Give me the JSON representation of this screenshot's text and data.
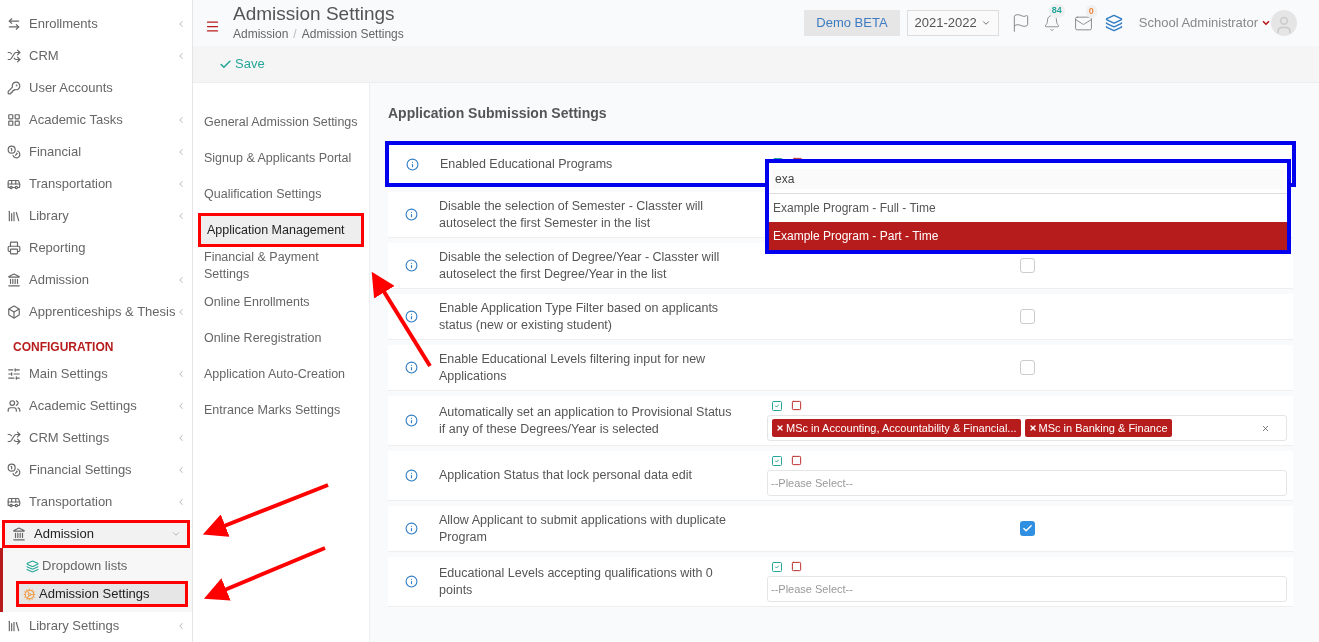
{
  "sidebar": {
    "items": [
      {
        "label": "Enrollments",
        "expandable": true,
        "expanded": false,
        "annotated": false
      },
      {
        "label": "CRM",
        "expandable": true,
        "expanded": false,
        "annotated": false
      },
      {
        "label": "User Accounts",
        "expandable": false,
        "annotated": false
      },
      {
        "label": "Academic Tasks",
        "expandable": true,
        "expanded": false,
        "annotated": false
      },
      {
        "label": "Financial",
        "expandable": true,
        "expanded": false,
        "annotated": false
      },
      {
        "label": "Transportation",
        "expandable": true,
        "expanded": false,
        "annotated": false
      },
      {
        "label": "Library",
        "expandable": true,
        "expanded": false,
        "annotated": false
      },
      {
        "label": "Reporting",
        "expandable": false,
        "annotated": false
      },
      {
        "label": "Admission",
        "expandable": true,
        "expanded": false,
        "annotated": false
      },
      {
        "label": "Apprenticeships & Thesis",
        "expandable": true,
        "expanded": false,
        "annotated": false
      }
    ],
    "section_header": "CONFIGURATION",
    "config_items": [
      {
        "label": "Main Settings",
        "expandable": true,
        "expanded": false,
        "annotated": false
      },
      {
        "label": "Academic Settings",
        "expandable": true,
        "expanded": false,
        "annotated": false
      },
      {
        "label": "CRM Settings",
        "expandable": true,
        "expanded": false,
        "annotated": false
      },
      {
        "label": "Financial Settings",
        "expandable": true,
        "expanded": false,
        "annotated": false
      },
      {
        "label": "Transportation",
        "expandable": true,
        "expanded": false,
        "annotated": false
      },
      {
        "label": "Admission",
        "expandable": true,
        "expanded": true,
        "annotated": true,
        "children": [
          {
            "label": "Dropdown lists",
            "selected": false,
            "annotated": false
          },
          {
            "label": "Admission Settings",
            "selected": true,
            "annotated": true
          }
        ]
      },
      {
        "label": "Library Settings",
        "expandable": true,
        "expanded": false,
        "annotated": false
      }
    ]
  },
  "header": {
    "title": "Admission Settings",
    "breadcrumb": [
      "Admission",
      "Admission Settings"
    ],
    "breadcrumb_separator": "/",
    "demo_button": "Demo BETA",
    "year_select": "2021-2022",
    "notifications_badge": "84",
    "messages_badge": "0",
    "user": "School Administrator"
  },
  "toolbar": {
    "save": "Save"
  },
  "settings_nav": [
    {
      "label": "General Admission Settings",
      "selected": false,
      "annotated": false
    },
    {
      "label": "Signup & Applicants Portal",
      "selected": false,
      "annotated": false
    },
    {
      "label": "Qualification Settings",
      "selected": false,
      "annotated": false
    },
    {
      "label": "Application Management",
      "selected": true,
      "annotated": true
    },
    {
      "label": "Financial & Payment Settings",
      "selected": false,
      "annotated": false
    },
    {
      "label": "Online Enrollments",
      "selected": false,
      "annotated": false
    },
    {
      "label": "Online Reregistration",
      "selected": false,
      "annotated": false
    },
    {
      "label": "Application Auto-Creation",
      "selected": false,
      "annotated": false
    },
    {
      "label": "Entrance Marks Settings",
      "selected": false,
      "annotated": false
    }
  ],
  "section_title": "Application Submission Settings",
  "rows": [
    {
      "label": "Enabled Educational Programs",
      "kind": "multiselect",
      "annotated": true,
      "dropdown": {
        "search": "exa",
        "annotated": true,
        "options": [
          {
            "label": "Example Program - Full - Time",
            "selected": false
          },
          {
            "label": "Example Program - Part - Time",
            "selected": true
          }
        ]
      }
    },
    {
      "label": "Disable the selection of Semester - Classter will autoselect the first Semester in the list",
      "kind": "covered",
      "annotated": false
    },
    {
      "label": "Disable the selection of Degree/Year - Classter will autoselect the first Degree/Year in the list",
      "kind": "checkbox",
      "checked": false,
      "annotated": false
    },
    {
      "label": "Enable Application Type Filter based on applicants status (new or existing student)",
      "kind": "checkbox",
      "checked": false,
      "annotated": false
    },
    {
      "label": "Enable Educational Levels filtering input for new Applications",
      "kind": "checkbox",
      "checked": false,
      "annotated": false
    },
    {
      "label": "Automatically set an application to Provisional Status if any of these Degrees/Year is selected",
      "kind": "tags",
      "annotated": false,
      "tags": [
        "MSc in Accounting, Accountability & Financial...",
        "MSc in Banking & Finance"
      ]
    },
    {
      "label": "Application Status that lock personal data edit",
      "kind": "select",
      "annotated": false,
      "placeholder": "--Please Select--"
    },
    {
      "label": "Allow Applicant to submit applications with duplicate Program",
      "kind": "checkbox",
      "checked": true,
      "annotated": false
    },
    {
      "label": "Educational Levels accepting qualifications with 0 points",
      "kind": "select",
      "annotated": false,
      "placeholder": "--Please Select--"
    }
  ]
}
